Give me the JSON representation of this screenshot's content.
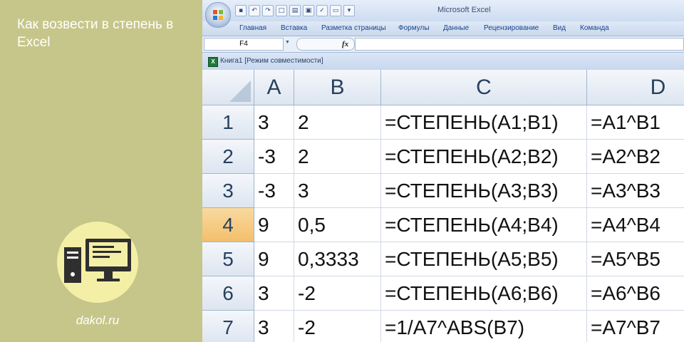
{
  "article": {
    "title": "Как возвести в степень в Excel",
    "site": "dakol.ru"
  },
  "excel": {
    "app_title": "Microsoft Excel",
    "ribbon_tabs": [
      "Главная",
      "Вставка",
      "Разметка страницы",
      "Формулы",
      "Данные",
      "Рецензирование",
      "Вид",
      "Команда"
    ],
    "name_box": "F4",
    "fx_label": "fx",
    "formula_value": "",
    "workbook_title": "Книга1  [Режим совместимости]",
    "columns": [
      "A",
      "B",
      "C",
      "D"
    ],
    "selected_row": 4,
    "rows": [
      {
        "num": "1",
        "cells": [
          "3",
          "2",
          "=СТЕПЕНЬ(A1;B1)",
          "=A1^B1"
        ]
      },
      {
        "num": "2",
        "cells": [
          "-3",
          "2",
          "=СТЕПЕНЬ(A2;B2)",
          "=A2^B2"
        ]
      },
      {
        "num": "3",
        "cells": [
          "-3",
          "3",
          "=СТЕПЕНЬ(A3;B3)",
          "=A3^B3"
        ]
      },
      {
        "num": "4",
        "cells": [
          "9",
          "0,5",
          "=СТЕПЕНЬ(A4;B4)",
          "=A4^B4"
        ]
      },
      {
        "num": "5",
        "cells": [
          "9",
          "0,3333",
          "=СТЕПЕНЬ(A5;B5)",
          "=A5^B5"
        ]
      },
      {
        "num": "6",
        "cells": [
          "3",
          "-2",
          "=СТЕПЕНЬ(A6;B6)",
          "=A6^B6"
        ]
      },
      {
        "num": "7",
        "cells": [
          "3",
          "-2",
          "=1/A7^ABS(B7)",
          "=A7^B7"
        ]
      }
    ]
  },
  "colors": {
    "panel": "#c6c68a",
    "logo_circle": "#f4efa6",
    "selected_row_header": "#f3bf6b",
    "header_text": "#27415f"
  }
}
